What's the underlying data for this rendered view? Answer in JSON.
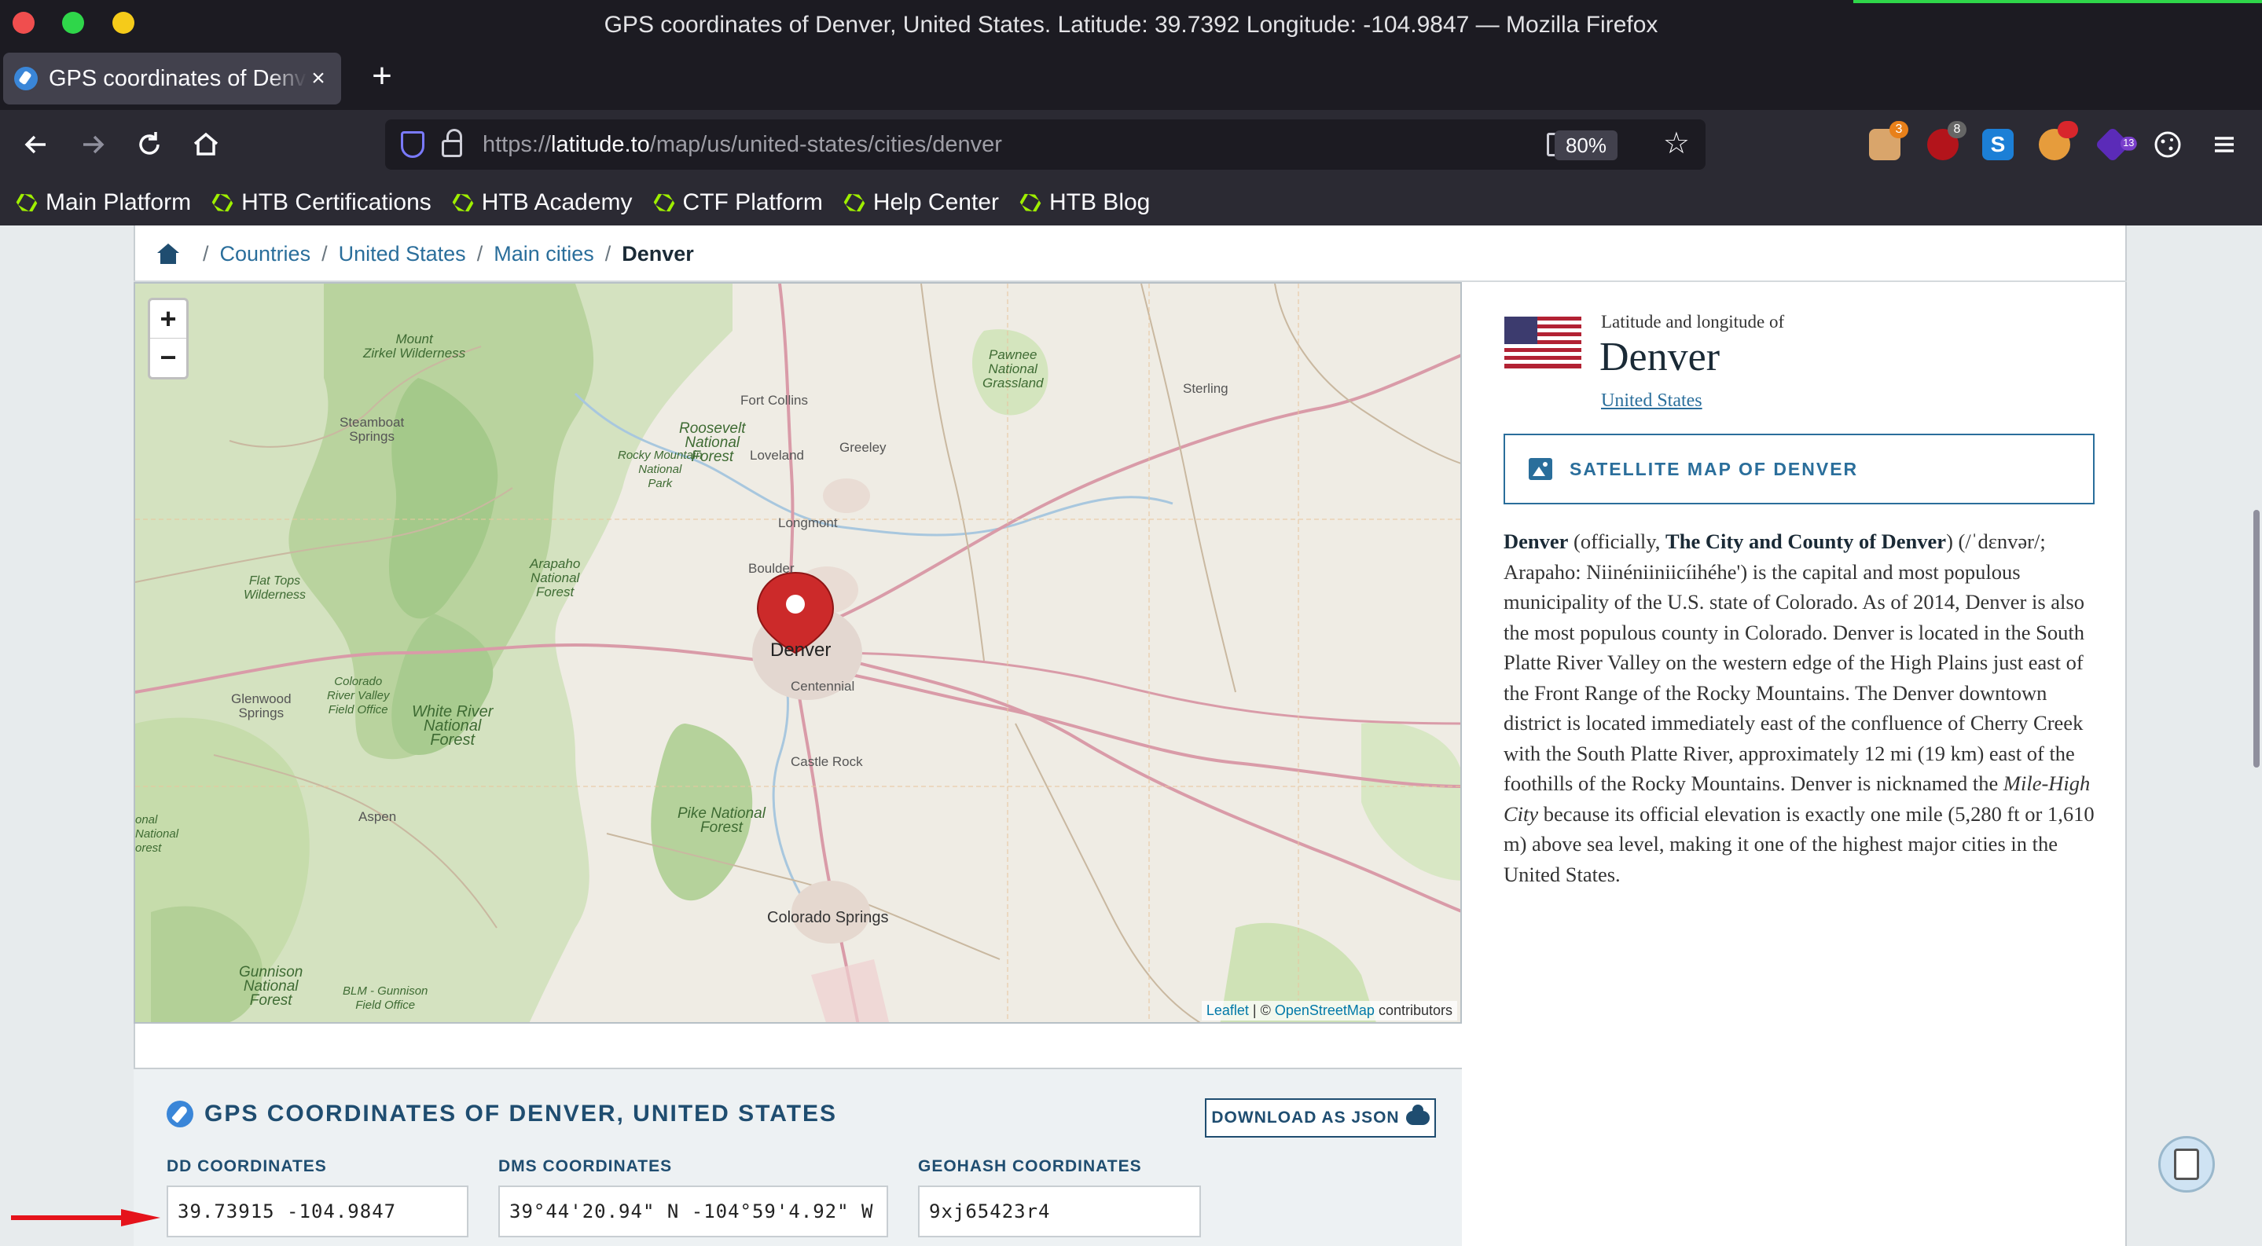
{
  "window": {
    "title": "GPS coordinates of Denver, United States. Latitude: 39.7392 Longitude: -104.9847 — Mozilla Firefox"
  },
  "tab": {
    "title": "GPS coordinates of Denver, United States",
    "close": "×",
    "new_tab": "+"
  },
  "nav": {
    "url_prefix": "https://",
    "url_host": "latitude.to",
    "url_path": "/map/us/united-states/cities/denver",
    "zoom": "80%",
    "extensions": [
      {
        "name": "ext-1",
        "badge": "3",
        "badge_color": "#e8801a"
      },
      {
        "name": "ext-ublock",
        "badge": "8",
        "badge_color": "#666"
      },
      {
        "name": "ext-s"
      },
      {
        "name": "ext-4"
      },
      {
        "name": "ext-5",
        "badge": "13",
        "badge_color": "#7a3fcc"
      }
    ]
  },
  "bookmarks": [
    "Main Platform",
    "HTB Certifications",
    "HTB Academy",
    "CTF Platform",
    "Help Center",
    "HTB Blog"
  ],
  "breadcrumb": {
    "items": [
      "Countries",
      "United States",
      "Main cities"
    ],
    "current": "Denver",
    "separator": "/"
  },
  "map": {
    "zoom_in": "+",
    "zoom_out": "−",
    "attribution_leaflet": "Leaflet",
    "attribution_sep": " | © ",
    "attribution_osm": "OpenStreetMap",
    "attribution_suffix": " contributors",
    "labels": {
      "mount_zirkel": "Mount\nZirkel Wilderness",
      "steamboat": "Steamboat\nSprings",
      "fort_collins": "Fort Collins",
      "pawnee": "Pawnee\nNational\nGrassland",
      "sterling": "Sterling",
      "roosevelt": "Roosevelt\nNational\nForest",
      "rmnp": "Rocky Mountain\nNational\nPark",
      "loveland": "Loveland",
      "greeley": "Greeley",
      "longmont": "Longmont",
      "boulder": "Boulder",
      "arapaho": "Arapaho\nNational\nForest",
      "flat_tops": "Flat Tops\nWilderness",
      "denver": "Denver",
      "centennial": "Centennial",
      "co_river": "Colorado\nRiver Valley\nField Office",
      "glenwood": "Glenwood\nSprings",
      "white_river": "White River\nNational\nForest",
      "castle_rock": "Castle Rock",
      "aspen": "Aspen",
      "pike": "Pike National\nForest",
      "national_forest": "onal\nNational\norest",
      "co_springs": "Colorado Springs",
      "gunnison": "Gunnison\nNational\nForest",
      "blm": "BLM - Gunnison\nField Office"
    }
  },
  "info": {
    "subtitle": "Latitude and longitude of",
    "city": "Denver",
    "country": "United States",
    "satellite_button": "SATELLITE MAP OF DENVER",
    "desc_1": "Denver",
    "desc_2": " (officially, ",
    "desc_3": "The City and County of Denver",
    "desc_4": ") (/ˈdɛnvər/; Arapaho: Niinéniiniicíihéhe') is the capital and most populous municipality of the U.S. state of Colorado. As of 2014, Denver is also the most populous county in Colorado. Denver is located in the South Platte River Valley on the western edge of the High Plains just east of the Front Range of the Rocky Mountains. The Denver downtown district is located immediately east of the confluence of Cherry Creek with the South Platte River, approximately 12 mi (19 km) east of the foothills of the Rocky Mountains. Denver is nicknamed the ",
    "desc_5": "Mile-High City",
    "desc_6": " because its official elevation is exactly one mile (5,280 ft or 1,610 m) above sea level, making it one of the highest major cities in the United States."
  },
  "gps": {
    "title": "GPS COORDINATES OF DENVER, UNITED STATES",
    "download_button": "DOWNLOAD AS JSON",
    "dd_label": "DD COORDINATES",
    "dd_value": "39.73915 -104.9847",
    "dms_label": "DMS COORDINATES",
    "dms_value": "39°44'20.94\" N -104°59'4.92\" W",
    "geohash_label": "GEOHASH COORDINATES",
    "geohash_value": "9xj65423r4"
  },
  "colors": {
    "accent": "#2a6e9b",
    "dark_blue": "#1f4d70",
    "marker": "#cc2a2a",
    "arrow": "#e5131b"
  }
}
